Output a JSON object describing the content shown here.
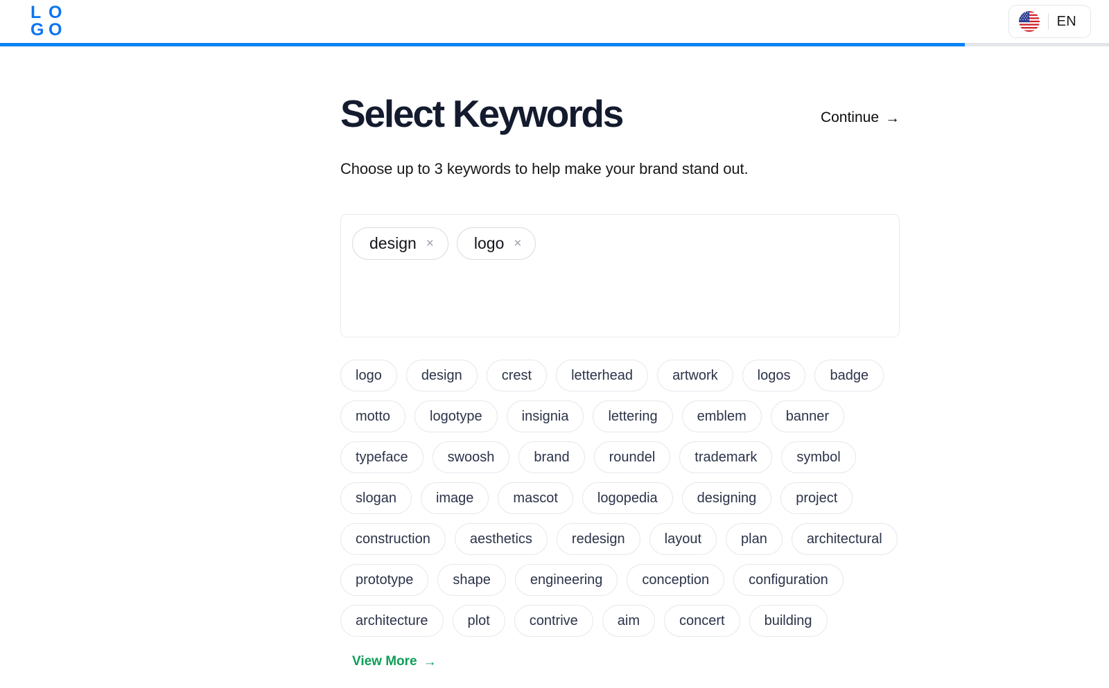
{
  "header": {
    "logo": {
      "name": "LOGO",
      "cells": [
        "L",
        "O",
        "G",
        "O"
      ],
      "color": "#0b74f0"
    },
    "language_button": {
      "flag_icon": "us-flag-icon",
      "label": "EN"
    }
  },
  "progress": {
    "percent": 87,
    "fill_color": "#0b82f5",
    "track_color": "#e3e5e8"
  },
  "main": {
    "title": "Select Keywords",
    "continue_label": "Continue",
    "continue_arrow": "→",
    "subtitle": "Choose up to 3 keywords to help make your brand stand out.",
    "selected_keywords": [
      {
        "label": "design",
        "remove_icon": "×"
      },
      {
        "label": "logo",
        "remove_icon": "×"
      }
    ],
    "suggested_keywords": [
      "logo",
      "design",
      "crest",
      "letterhead",
      "artwork",
      "logos",
      "badge",
      "motto",
      "logotype",
      "insignia",
      "lettering",
      "emblem",
      "banner",
      "typeface",
      "swoosh",
      "brand",
      "roundel",
      "trademark",
      "symbol",
      "slogan",
      "image",
      "mascot",
      "logopedia",
      "designing",
      "project",
      "construction",
      "aesthetics",
      "redesign",
      "layout",
      "plan",
      "architectural",
      "prototype",
      "shape",
      "engineering",
      "conception",
      "configuration",
      "architecture",
      "plot",
      "contrive",
      "aim",
      "concert",
      "building"
    ],
    "view_more_label": "View More",
    "view_more_arrow": "→",
    "view_more_color": "#0f9d58"
  }
}
